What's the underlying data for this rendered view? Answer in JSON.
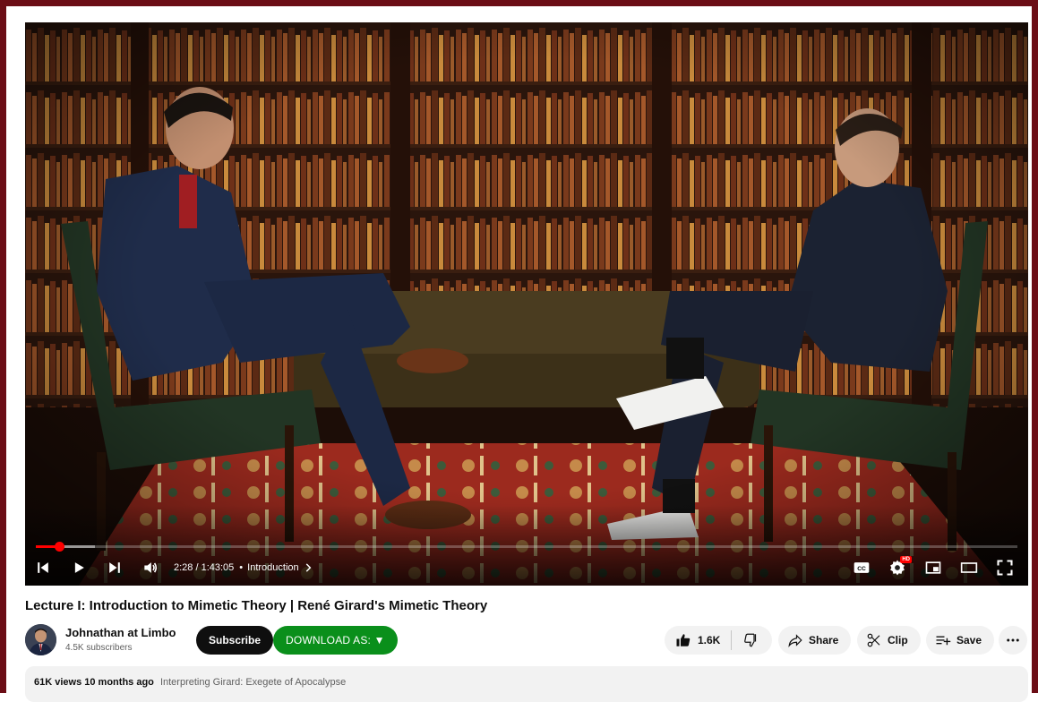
{
  "player": {
    "time_current": "2:28",
    "time_total": "1:43:05",
    "time_display": "2:28 / 1:43:05",
    "chapter": "Introduction",
    "progress_played": 0.024,
    "progress_loaded": 0.06,
    "hd_badge": "HD",
    "cc_label": "CC"
  },
  "video": {
    "title": "Lecture I: Introduction to Mimetic Theory | René Girard's Mimetic Theory"
  },
  "channel": {
    "name": "Johnathan at Limbo",
    "subscribers": "4.5K subscribers",
    "subscribe_label": "Subscribe",
    "download_label": "DOWNLOAD AS: ▼"
  },
  "actions": {
    "likes": "1.6K",
    "share": "Share",
    "clip": "Clip",
    "save": "Save"
  },
  "description": {
    "views": "61K views",
    "date": "10 months ago",
    "tag": "Interpreting Girard: Exegete of Apocalypse"
  },
  "colors": {
    "frame": "#6b0d15",
    "progress": "#ff0000",
    "download": "#0a8f1b",
    "subscribe": "#0f0f0f"
  }
}
